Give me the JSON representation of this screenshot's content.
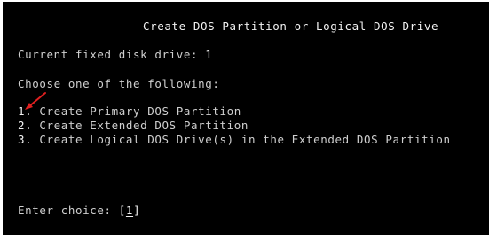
{
  "screen": {
    "title": "Create DOS Partition or Logical DOS Drive",
    "current_drive_label": "Current fixed disk drive:",
    "current_drive_value": "1",
    "choose_prompt": "Choose one of the following:",
    "options": [
      {
        "number": "1.",
        "label": "Create Primary DOS Partition"
      },
      {
        "number": "2.",
        "label": "Create Extended DOS Partition"
      },
      {
        "number": "3.",
        "label": "Create Logical DOS Drive(s) in the Extended DOS Partition"
      }
    ],
    "enter_choice_label": "Enter choice:",
    "choice_open_bracket": "[",
    "choice_value": "1",
    "choice_close_bracket": "]"
  },
  "colors": {
    "background": "#000000",
    "text": "#cfcfcf",
    "bright_text": "#f2f2f2",
    "annotation_arrow": "#e02020"
  },
  "annotation": {
    "icon": "red-arrow-pointer-icon"
  }
}
